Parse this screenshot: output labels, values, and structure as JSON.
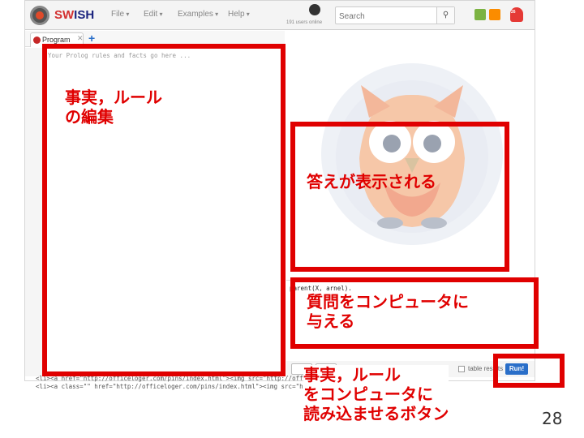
{
  "app": {
    "brand": "SWISH",
    "brand_prefix": "SW",
    "brand_suffix": "ISH",
    "users_online": "191 users online"
  },
  "menu": {
    "file": "File",
    "edit": "Edit",
    "examples": "Examples",
    "help": "Help"
  },
  "search": {
    "placeholder": "Search"
  },
  "notifications": {
    "count": "26"
  },
  "tabs": [
    {
      "label": "Program"
    }
  ],
  "editor": {
    "placeholder": "Your Prolog rules and facts go here ..."
  },
  "query": {
    "text": "parent(X, arnel)."
  },
  "query_bar": {
    "table_results_label": "table results",
    "run_label": "Run!"
  },
  "html_snippet": {
    "line1": "<li><a href=\"http://officeloger.com/pins/index.html\"><img src=\"http://officeloger.com/p...kf",
    "line2": "<li><a class=\"\" href=\"http://officeloger.com/pins/index.html\"><img src=\"http://officeloger.com/"
  },
  "annotations": {
    "edit_rules_line1": "事実，ルール",
    "edit_rules_line2": "の編集",
    "answers_shown": "答えが表示される",
    "give_query_line1": "質問をコンピュータに",
    "give_query_line2": "与える",
    "load_button_line1": "事実，ルール",
    "load_button_line2": "をコンピュータに",
    "load_button_line3": "読み込ませるボタン"
  },
  "page_number": "28",
  "colors": {
    "annotation_red": "#e00000",
    "run_button_blue": "#2a6fc9"
  }
}
